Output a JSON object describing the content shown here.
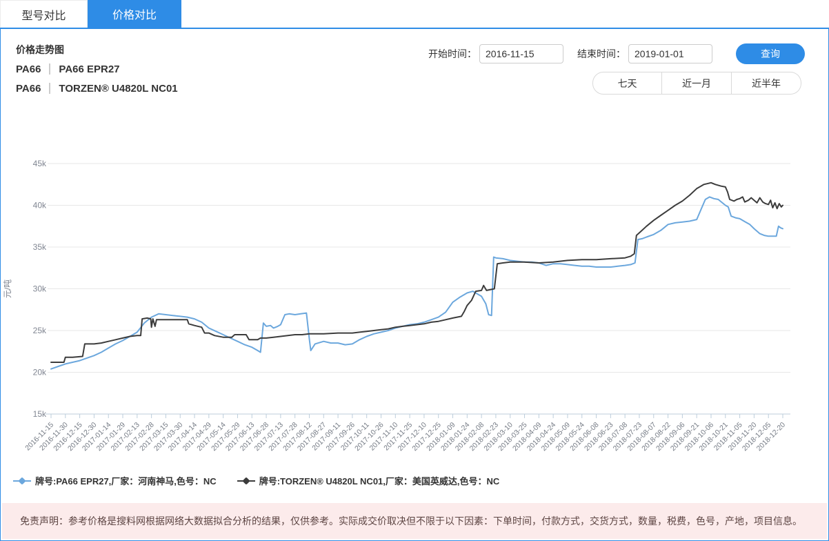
{
  "tabs": [
    {
      "label": "型号对比",
      "active": false
    },
    {
      "label": "价格对比",
      "active": true
    }
  ],
  "header": {
    "chart_title": "价格走势图",
    "products": [
      {
        "category": "PA66",
        "name": "PA66 EPR27"
      },
      {
        "category": "PA66",
        "name": "TORZEN® U4820L NC01"
      }
    ],
    "start_label": "开始时间：",
    "start_value": "2016-11-15",
    "end_label": "结束时间：",
    "end_value": "2019-01-01",
    "query_label": "查询",
    "range_buttons": [
      "七天",
      "近一月",
      "近半年"
    ]
  },
  "colors": {
    "accent_blue": "#2e8ce6",
    "series_blue": "#6ba7dd",
    "series_dark": "#3c3c3c",
    "gridline": "#e7e7e7",
    "axis_line": "#bccddb",
    "axis_text": "#808692",
    "disclaimer_bg": "#fcebeb",
    "disclaimer_text": "#5d4543"
  },
  "chart_data": {
    "type": "line",
    "title": "价格走势图",
    "ylabel": "元/吨",
    "ylim": [
      15000,
      45000
    ],
    "grid": true,
    "legend_position": "bottom-left",
    "y_ticks": [
      {
        "label": "45k",
        "value": 45
      },
      {
        "label": "40k",
        "value": 40
      },
      {
        "label": "35k",
        "value": 35
      },
      {
        "label": "30k",
        "value": 30
      },
      {
        "label": "25k",
        "value": 25
      },
      {
        "label": "20k",
        "value": 20
      },
      {
        "label": "15k",
        "value": 15
      }
    ],
    "categories": [
      "2016-11-15",
      "2016-11-30",
      "2016-12-15",
      "2016-12-30",
      "2017-01-14",
      "2017-01-29",
      "2017-02-13",
      "2017-02-28",
      "2017-03-15",
      "2017-03-30",
      "2017-04-14",
      "2017-04-29",
      "2017-05-14",
      "2017-05-29",
      "2017-06-13",
      "2017-06-28",
      "2017-07-13",
      "2017-07-28",
      "2017-08-12",
      "2017-08-27",
      "2017-09-11",
      "2017-09-26",
      "2017-10-11",
      "2017-10-26",
      "2017-11-10",
      "2017-11-25",
      "2017-12-10",
      "2017-12-25",
      "2018-01-09",
      "2018-01-24",
      "2018-02-08",
      "2018-02-23",
      "2018-03-10",
      "2018-03-25",
      "2018-04-09",
      "2018-04-24",
      "2018-05-09",
      "2018-05-24",
      "2018-06-08",
      "2018-06-23",
      "2018-07-08",
      "2018-07-23",
      "2018-08-07",
      "2018-08-22",
      "2018-09-06",
      "2018-09-21",
      "2018-10-06",
      "2018-10-21",
      "2018-11-05",
      "2018-11-20",
      "2018-12-05",
      "2018-12-20"
    ],
    "values_unit": "thousand 元/吨, x = fractional index into categories",
    "series": [
      {
        "name": "牌号:PA66 EPR27,厂家：河南神马,色号：NC",
        "color": "#6ba7dd",
        "points": [
          [
            0,
            20.4
          ],
          [
            0.5,
            20.7
          ],
          [
            1,
            21.0
          ],
          [
            1.5,
            21.2
          ],
          [
            2,
            21.4
          ],
          [
            2.5,
            21.7
          ],
          [
            3,
            22.0
          ],
          [
            3.5,
            22.4
          ],
          [
            4,
            22.9
          ],
          [
            4.5,
            23.4
          ],
          [
            5,
            23.8
          ],
          [
            5.5,
            24.3
          ],
          [
            6,
            24.8
          ],
          [
            6.5,
            25.9
          ],
          [
            7,
            26.6
          ],
          [
            7.5,
            27.0
          ],
          [
            8,
            26.9
          ],
          [
            8.5,
            26.8
          ],
          [
            9,
            26.7
          ],
          [
            9.5,
            26.6
          ],
          [
            10,
            26.4
          ],
          [
            10.5,
            26.0
          ],
          [
            11,
            25.3
          ],
          [
            11.5,
            24.9
          ],
          [
            12,
            24.5
          ],
          [
            12.5,
            24.1
          ],
          [
            13,
            23.7
          ],
          [
            13.5,
            23.3
          ],
          [
            14,
            23.0
          ],
          [
            14.4,
            22.6
          ],
          [
            14.6,
            22.4
          ],
          [
            14.8,
            25.9
          ],
          [
            15,
            25.5
          ],
          [
            15.3,
            25.6
          ],
          [
            15.5,
            25.3
          ],
          [
            15.8,
            25.5
          ],
          [
            16,
            25.7
          ],
          [
            16.3,
            26.9
          ],
          [
            16.6,
            27.0
          ],
          [
            17,
            26.9
          ],
          [
            17.4,
            27.0
          ],
          [
            17.8,
            27.1
          ],
          [
            18,
            24.0
          ],
          [
            18.1,
            22.6
          ],
          [
            18.4,
            23.4
          ],
          [
            19,
            23.7
          ],
          [
            19.5,
            23.5
          ],
          [
            20,
            23.5
          ],
          [
            20.5,
            23.3
          ],
          [
            21,
            23.4
          ],
          [
            21.5,
            23.9
          ],
          [
            22,
            24.3
          ],
          [
            22.5,
            24.6
          ],
          [
            23,
            24.8
          ],
          [
            23.5,
            25.0
          ],
          [
            24,
            25.3
          ],
          [
            24.5,
            25.5
          ],
          [
            25,
            25.7
          ],
          [
            25.5,
            25.8
          ],
          [
            26,
            26.0
          ],
          [
            26.5,
            26.3
          ],
          [
            27,
            26.6
          ],
          [
            27.5,
            27.2
          ],
          [
            28,
            28.4
          ],
          [
            28.5,
            29.0
          ],
          [
            29,
            29.5
          ],
          [
            29.4,
            29.7
          ],
          [
            29.8,
            29.3
          ],
          [
            30,
            29.1
          ],
          [
            30.3,
            28.2
          ],
          [
            30.5,
            26.9
          ],
          [
            30.7,
            26.8
          ],
          [
            30.85,
            33.8
          ],
          [
            31,
            33.7
          ],
          [
            31.5,
            33.6
          ],
          [
            32,
            33.4
          ],
          [
            32.5,
            33.3
          ],
          [
            33,
            33.2
          ],
          [
            33.5,
            33.2
          ],
          [
            34,
            33.1
          ],
          [
            34.5,
            32.8
          ],
          [
            35,
            33.0
          ],
          [
            35.5,
            33.0
          ],
          [
            36,
            32.9
          ],
          [
            36.5,
            32.8
          ],
          [
            37,
            32.7
          ],
          [
            37.5,
            32.7
          ],
          [
            38,
            32.6
          ],
          [
            38.5,
            32.6
          ],
          [
            39,
            32.6
          ],
          [
            39.5,
            32.7
          ],
          [
            40,
            32.8
          ],
          [
            40.4,
            32.9
          ],
          [
            40.7,
            33.1
          ],
          [
            40.9,
            35.9
          ],
          [
            41.2,
            36.0
          ],
          [
            41.5,
            36.2
          ],
          [
            42,
            36.5
          ],
          [
            42.5,
            37.0
          ],
          [
            43,
            37.7
          ],
          [
            43.5,
            37.9
          ],
          [
            44,
            38.0
          ],
          [
            44.5,
            38.1
          ],
          [
            45,
            38.3
          ],
          [
            45.3,
            39.5
          ],
          [
            45.6,
            40.7
          ],
          [
            45.9,
            41.0
          ],
          [
            46.2,
            40.8
          ],
          [
            46.5,
            40.7
          ],
          [
            47,
            40.0
          ],
          [
            47.2,
            39.8
          ],
          [
            47.4,
            38.7
          ],
          [
            47.7,
            38.5
          ],
          [
            48,
            38.4
          ],
          [
            48.4,
            38.0
          ],
          [
            48.7,
            37.7
          ],
          [
            49,
            37.2
          ],
          [
            49.4,
            36.6
          ],
          [
            49.7,
            36.4
          ],
          [
            50,
            36.3
          ],
          [
            50.3,
            36.3
          ],
          [
            50.55,
            36.3
          ],
          [
            50.7,
            37.5
          ],
          [
            50.85,
            37.3
          ],
          [
            51,
            37.2
          ]
        ]
      },
      {
        "name": "牌号:TORZEN® U4820L NC01,厂家：美国英威达,色号：NC",
        "color": "#3c3c3c",
        "points": [
          [
            0,
            21.2
          ],
          [
            0.9,
            21.2
          ],
          [
            1,
            21.8
          ],
          [
            1.5,
            21.8
          ],
          [
            2.2,
            21.9
          ],
          [
            2.35,
            23.4
          ],
          [
            3,
            23.4
          ],
          [
            3.5,
            23.5
          ],
          [
            4,
            23.7
          ],
          [
            4.5,
            23.9
          ],
          [
            5,
            24.1
          ],
          [
            5.5,
            24.3
          ],
          [
            6,
            24.4
          ],
          [
            6.25,
            24.4
          ],
          [
            6.35,
            26.4
          ],
          [
            6.7,
            26.5
          ],
          [
            6.95,
            26.4
          ],
          [
            7,
            25.4
          ],
          [
            7.1,
            26.4
          ],
          [
            7.25,
            25.5
          ],
          [
            7.35,
            26.3
          ],
          [
            8,
            26.3
          ],
          [
            8.5,
            26.3
          ],
          [
            9,
            26.3
          ],
          [
            9.5,
            26.3
          ],
          [
            9.6,
            25.8
          ],
          [
            10,
            25.6
          ],
          [
            10.5,
            25.4
          ],
          [
            10.7,
            24.7
          ],
          [
            11,
            24.7
          ],
          [
            11.4,
            24.4
          ],
          [
            12,
            24.2
          ],
          [
            12.6,
            24.2
          ],
          [
            12.8,
            24.5
          ],
          [
            13.6,
            24.5
          ],
          [
            13.8,
            23.9
          ],
          [
            14.4,
            23.9
          ],
          [
            14.6,
            24.1
          ],
          [
            15,
            24.1
          ],
          [
            15.5,
            24.2
          ],
          [
            16,
            24.3
          ],
          [
            16.5,
            24.4
          ],
          [
            17,
            24.5
          ],
          [
            17.5,
            24.5
          ],
          [
            18,
            24.6
          ],
          [
            19,
            24.6
          ],
          [
            20,
            24.7
          ],
          [
            21,
            24.7
          ],
          [
            21.5,
            24.8
          ],
          [
            22,
            24.9
          ],
          [
            22.5,
            25.0
          ],
          [
            23,
            25.1
          ],
          [
            23.5,
            25.2
          ],
          [
            24,
            25.4
          ],
          [
            24.5,
            25.5
          ],
          [
            25,
            25.6
          ],
          [
            25.5,
            25.7
          ],
          [
            26,
            25.8
          ],
          [
            26.5,
            26.0
          ],
          [
            27,
            26.1
          ],
          [
            27.5,
            26.3
          ],
          [
            28,
            26.5
          ],
          [
            28.6,
            26.7
          ],
          [
            28.8,
            27.3
          ],
          [
            29,
            28.0
          ],
          [
            29.3,
            28.6
          ],
          [
            29.6,
            29.7
          ],
          [
            30,
            29.8
          ],
          [
            30.15,
            30.4
          ],
          [
            30.35,
            29.8
          ],
          [
            30.9,
            30.0
          ],
          [
            31.1,
            33.0
          ],
          [
            31.5,
            33.1
          ],
          [
            32,
            33.2
          ],
          [
            33,
            33.2
          ],
          [
            34,
            33.1
          ],
          [
            35,
            33.2
          ],
          [
            36,
            33.4
          ],
          [
            37,
            33.5
          ],
          [
            38,
            33.5
          ],
          [
            39,
            33.6
          ],
          [
            40,
            33.7
          ],
          [
            40.4,
            33.9
          ],
          [
            40.65,
            34.2
          ],
          [
            40.8,
            36.4
          ],
          [
            41,
            36.7
          ],
          [
            41.5,
            37.5
          ],
          [
            42,
            38.2
          ],
          [
            42.5,
            38.8
          ],
          [
            43,
            39.4
          ],
          [
            43.5,
            40.0
          ],
          [
            44,
            40.5
          ],
          [
            44.5,
            41.2
          ],
          [
            45,
            42.0
          ],
          [
            45.5,
            42.5
          ],
          [
            46,
            42.7
          ],
          [
            46.3,
            42.5
          ],
          [
            46.7,
            42.3
          ],
          [
            47,
            42.2
          ],
          [
            47.15,
            41.6
          ],
          [
            47.3,
            40.7
          ],
          [
            47.6,
            40.5
          ],
          [
            47.8,
            40.7
          ],
          [
            48,
            40.8
          ],
          [
            48.2,
            41.0
          ],
          [
            48.35,
            40.4
          ],
          [
            48.6,
            40.6
          ],
          [
            48.8,
            40.9
          ],
          [
            49,
            40.6
          ],
          [
            49.2,
            40.3
          ],
          [
            49.4,
            40.9
          ],
          [
            49.6,
            40.4
          ],
          [
            49.8,
            40.2
          ],
          [
            50,
            40.1
          ],
          [
            50.15,
            40.6
          ],
          [
            50.3,
            39.7
          ],
          [
            50.45,
            40.3
          ],
          [
            50.6,
            39.6
          ],
          [
            50.75,
            40.2
          ],
          [
            50.9,
            39.8
          ],
          [
            51,
            40.0
          ]
        ]
      }
    ]
  },
  "legend": [
    {
      "label": "牌号:PA66 EPR27,厂家：河南神马,色号：NC",
      "color": "#6ba7dd"
    },
    {
      "label": "牌号:TORZEN® U4820L NC01,厂家：美国英威达,色号：NC",
      "color": "#3c3c3c"
    }
  ],
  "disclaimer": "免责声明：参考价格是搜料网根据网络大数据拟合分析的结果，仅供参考。实际成交价取决但不限于以下因素：下单时间，付款方式，交货方式，数量，税费，色号，产地，项目信息。"
}
